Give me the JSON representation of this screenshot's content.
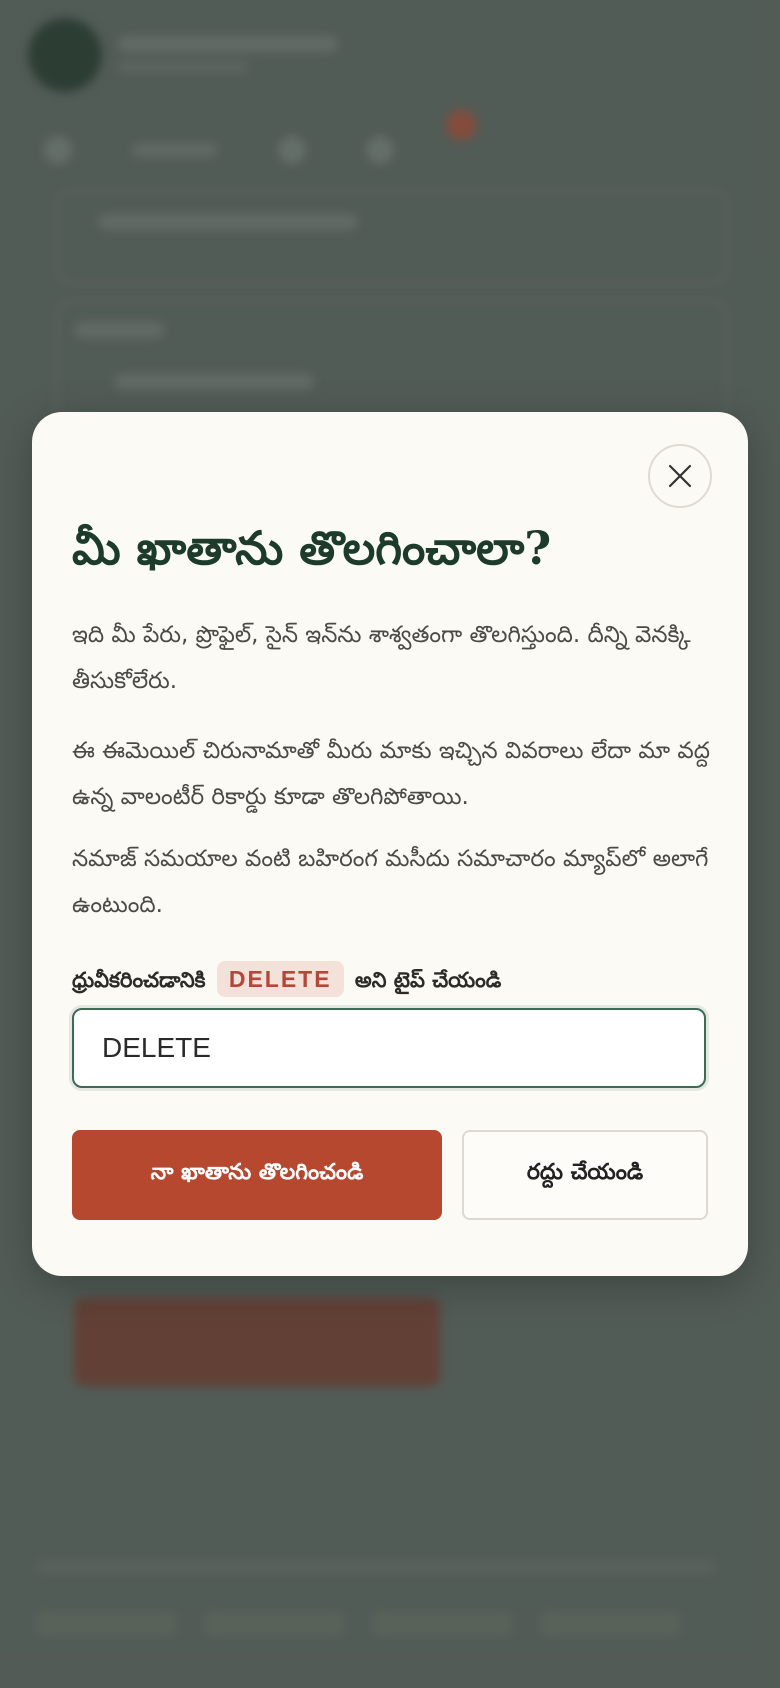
{
  "dialog": {
    "title": "మీ ఖాతాను తొలగించాలా?",
    "paragraph_1": "ఇది మీ పేరు, ప్రొఫైల్, సైన్ ఇన్‌ను శాశ్వతంగా తొలగిస్తుంది. దీన్ని వెనక్కి తీసుకోలేరు.",
    "paragraph_2": "ఈ ఈమెయిల్ చిరునామాతో మీరు మాకు ఇచ్చిన వివరాలు లేదా మా వద్ద ఉన్న వాలంటీర్ రికార్డు కూడా తొలగిపోతాయి.",
    "paragraph_3": "నమాజ్ సమయాల వంటి బహిరంగ మసీదు సమాచారం మ్యాప్‌లో అలాగే ఉంటుంది.",
    "confirm_prefix": "ధ్రువీకరించడానికి",
    "confirm_keyword": "DELETE",
    "confirm_suffix": "అని టైప్ చేయండి",
    "input_value": "DELETE",
    "delete_button_label": "నా ఖాతాను తొలగించండి",
    "cancel_button_label": "రద్దు చేయండి",
    "close_icon": "close-icon"
  },
  "colors": {
    "title": "#1d3b2b",
    "danger": "#b5482f",
    "keyword_bg": "#f4e2da",
    "keyword_text": "#b5473a",
    "input_border": "#3d6b55",
    "modal_bg": "#fcfaf5",
    "backdrop": "#56605a"
  }
}
